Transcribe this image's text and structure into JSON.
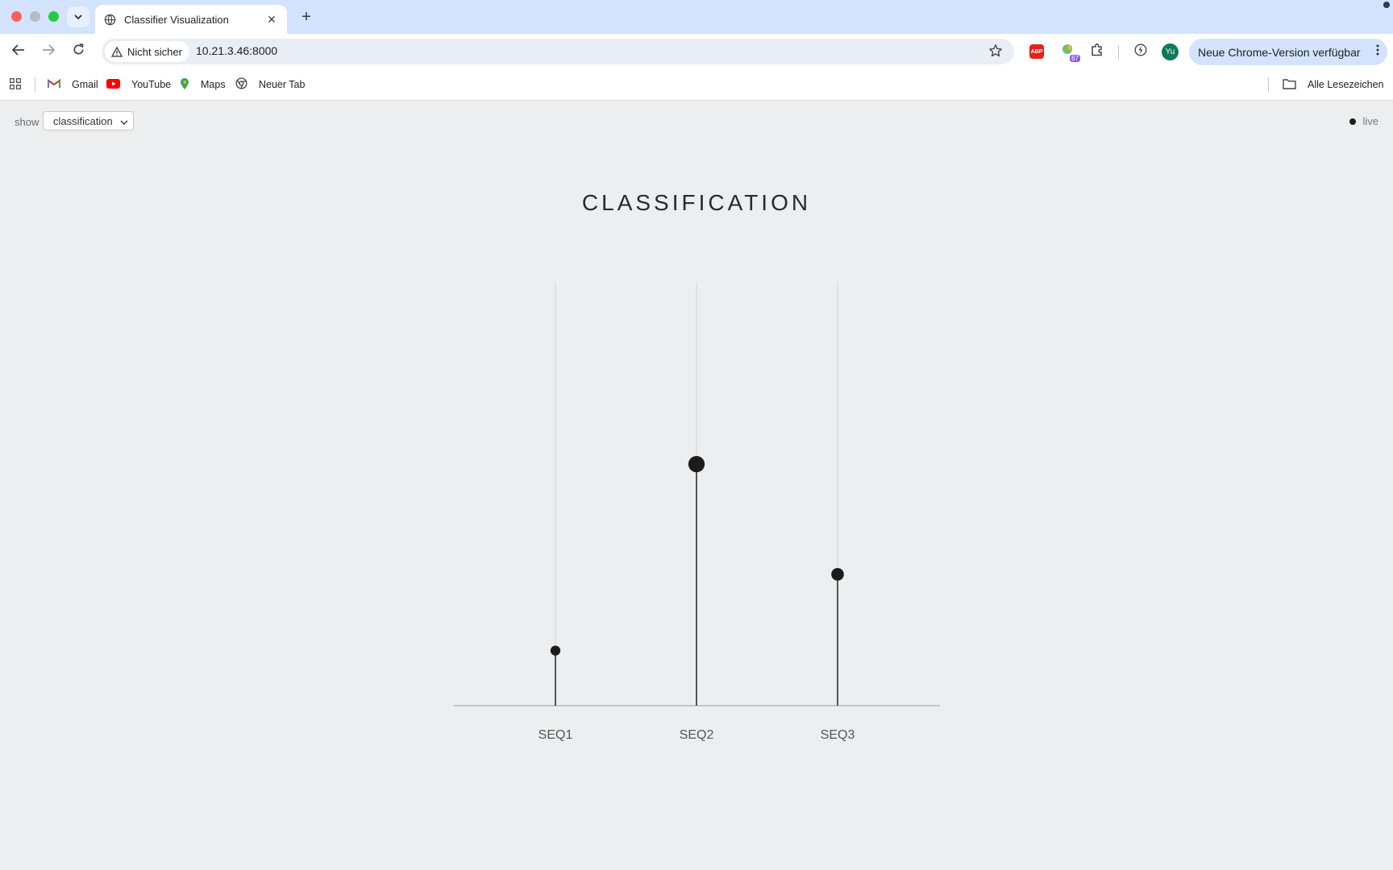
{
  "browser": {
    "tab_title": "Classifier Visualization",
    "security_label": "Nicht sicher",
    "url": "10.21.3.46:8000",
    "extension_badge": "67",
    "avatar_initials": "Yu",
    "update_label": "Neue Chrome-Version verfügbar",
    "bookmarks": [
      {
        "label": "Gmail",
        "icon": "gmail-icon"
      },
      {
        "label": "YouTube",
        "icon": "youtube-icon"
      },
      {
        "label": "Maps",
        "icon": "maps-icon"
      },
      {
        "label": "Neuer Tab",
        "icon": "chrome-icon"
      }
    ],
    "all_bookmarks_label": "Alle Lesezeichen"
  },
  "controls": {
    "show_label": "show",
    "show_value": "classification",
    "live_label": "live"
  },
  "chart_data": {
    "type": "lollipop",
    "title": "CLASSIFICATION",
    "categories": [
      "SEQ1",
      "SEQ2",
      "SEQ3"
    ],
    "values": [
      0.13,
      0.57,
      0.31
    ],
    "ylim": [
      0,
      1
    ],
    "grid": true,
    "colors": {
      "mark": "#1c1c1c",
      "stem": "#555555",
      "grid": "#cfd2d6",
      "axis": "#9a9a9a"
    }
  }
}
